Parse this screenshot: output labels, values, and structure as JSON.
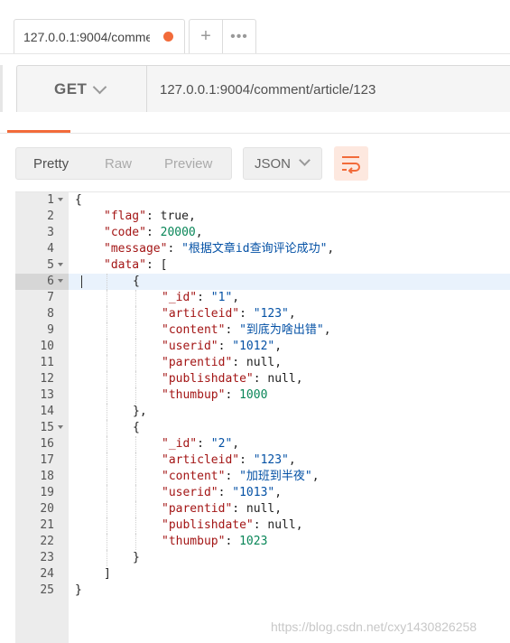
{
  "tab": {
    "label": "127.0.0.1:9004/comment/article/123",
    "add_label": "+",
    "more_label": "•••"
  },
  "request": {
    "method": "GET",
    "url": "127.0.0.1:9004/comment/article/123"
  },
  "response_view": {
    "modes": [
      "Pretty",
      "Raw",
      "Preview"
    ],
    "selected_mode": "Pretty",
    "format": "JSON"
  },
  "editor": {
    "highlighted_line": 6,
    "lines": [
      {
        "n": "1",
        "indent": 0,
        "fold": true,
        "tokens": [
          [
            "p",
            "{"
          ]
        ]
      },
      {
        "n": "2",
        "indent": 1,
        "fold": false,
        "tokens": [
          [
            "k",
            "\"flag\""
          ],
          [
            "p",
            ": "
          ],
          [
            "p",
            "true"
          ],
          [
            "p",
            ","
          ]
        ]
      },
      {
        "n": "3",
        "indent": 1,
        "fold": false,
        "tokens": [
          [
            "k",
            "\"code\""
          ],
          [
            "p",
            ": "
          ],
          [
            "n",
            "20000"
          ],
          [
            "p",
            ","
          ]
        ]
      },
      {
        "n": "4",
        "indent": 1,
        "fold": false,
        "tokens": [
          [
            "k",
            "\"message\""
          ],
          [
            "p",
            ": "
          ],
          [
            "s",
            "\"根据文章id查询评论成功\""
          ],
          [
            "p",
            ","
          ]
        ]
      },
      {
        "n": "5",
        "indent": 1,
        "fold": true,
        "tokens": [
          [
            "k",
            "\"data\""
          ],
          [
            "p",
            ": ["
          ]
        ]
      },
      {
        "n": "6",
        "indent": 2,
        "fold": true,
        "tokens": [
          [
            "p",
            "{"
          ]
        ]
      },
      {
        "n": "7",
        "indent": 3,
        "fold": false,
        "tokens": [
          [
            "k",
            "\"_id\""
          ],
          [
            "p",
            ": "
          ],
          [
            "s",
            "\"1\""
          ],
          [
            "p",
            ","
          ]
        ]
      },
      {
        "n": "8",
        "indent": 3,
        "fold": false,
        "tokens": [
          [
            "k",
            "\"articleid\""
          ],
          [
            "p",
            ": "
          ],
          [
            "s",
            "\"123\""
          ],
          [
            "p",
            ","
          ]
        ]
      },
      {
        "n": "9",
        "indent": 3,
        "fold": false,
        "tokens": [
          [
            "k",
            "\"content\""
          ],
          [
            "p",
            ": "
          ],
          [
            "s",
            "\"到底为啥出错\""
          ],
          [
            "p",
            ","
          ]
        ]
      },
      {
        "n": "10",
        "indent": 3,
        "fold": false,
        "tokens": [
          [
            "k",
            "\"userid\""
          ],
          [
            "p",
            ": "
          ],
          [
            "s",
            "\"1012\""
          ],
          [
            "p",
            ","
          ]
        ]
      },
      {
        "n": "11",
        "indent": 3,
        "fold": false,
        "tokens": [
          [
            "k",
            "\"parentid\""
          ],
          [
            "p",
            ": null,"
          ]
        ]
      },
      {
        "n": "12",
        "indent": 3,
        "fold": false,
        "tokens": [
          [
            "k",
            "\"publishdate\""
          ],
          [
            "p",
            ": null,"
          ]
        ]
      },
      {
        "n": "13",
        "indent": 3,
        "fold": false,
        "tokens": [
          [
            "k",
            "\"thumbup\""
          ],
          [
            "p",
            ": "
          ],
          [
            "n",
            "1000"
          ]
        ]
      },
      {
        "n": "14",
        "indent": 2,
        "fold": false,
        "tokens": [
          [
            "p",
            "},"
          ]
        ]
      },
      {
        "n": "15",
        "indent": 2,
        "fold": true,
        "tokens": [
          [
            "p",
            "{"
          ]
        ]
      },
      {
        "n": "16",
        "indent": 3,
        "fold": false,
        "tokens": [
          [
            "k",
            "\"_id\""
          ],
          [
            "p",
            ": "
          ],
          [
            "s",
            "\"2\""
          ],
          [
            "p",
            ","
          ]
        ]
      },
      {
        "n": "17",
        "indent": 3,
        "fold": false,
        "tokens": [
          [
            "k",
            "\"articleid\""
          ],
          [
            "p",
            ": "
          ],
          [
            "s",
            "\"123\""
          ],
          [
            "p",
            ","
          ]
        ]
      },
      {
        "n": "18",
        "indent": 3,
        "fold": false,
        "tokens": [
          [
            "k",
            "\"content\""
          ],
          [
            "p",
            ": "
          ],
          [
            "s",
            "\"加班到半夜\""
          ],
          [
            "p",
            ","
          ]
        ]
      },
      {
        "n": "19",
        "indent": 3,
        "fold": false,
        "tokens": [
          [
            "k",
            "\"userid\""
          ],
          [
            "p",
            ": "
          ],
          [
            "s",
            "\"1013\""
          ],
          [
            "p",
            ","
          ]
        ]
      },
      {
        "n": "20",
        "indent": 3,
        "fold": false,
        "tokens": [
          [
            "k",
            "\"parentid\""
          ],
          [
            "p",
            ": null,"
          ]
        ]
      },
      {
        "n": "21",
        "indent": 3,
        "fold": false,
        "tokens": [
          [
            "k",
            "\"publishdate\""
          ],
          [
            "p",
            ": null,"
          ]
        ]
      },
      {
        "n": "22",
        "indent": 3,
        "fold": false,
        "tokens": [
          [
            "k",
            "\"thumbup\""
          ],
          [
            "p",
            ": "
          ],
          [
            "n",
            "1023"
          ]
        ]
      },
      {
        "n": "23",
        "indent": 2,
        "fold": false,
        "tokens": [
          [
            "p",
            "}"
          ]
        ]
      },
      {
        "n": "24",
        "indent": 1,
        "fold": false,
        "tokens": [
          [
            "p",
            "]"
          ]
        ]
      },
      {
        "n": "25",
        "indent": 0,
        "fold": false,
        "tokens": [
          [
            "p",
            "}"
          ]
        ]
      }
    ]
  },
  "watermark": "https://blog.csdn.net/cxy1430826258",
  "colors": {
    "accent": "#f26b3a",
    "key": "#a31515",
    "string": "#0451a5",
    "number": "#098658"
  },
  "icons": {
    "unsaved": "dot-icon",
    "method_caret": "chevron-down-icon",
    "format_caret": "chevron-down-icon",
    "wrap": "wrap-lines-icon"
  }
}
